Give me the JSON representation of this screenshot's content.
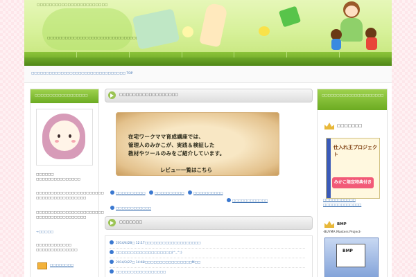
{
  "header": {
    "tagline": "□□□□□□□□□□□□□□□□□□□□□□□",
    "site_title": "□□□□□□□□□□□□□□□□□□□□□□□□□□□□□□□□□□□□□□"
  },
  "nav": {
    "items": [
      "",
      "",
      "",
      "",
      "",
      "",
      ""
    ]
  },
  "breadcrumb": "□□□□□□□□□□□□□□□□□□□□□□□□□□□□□□□□ TOP",
  "left": {
    "head": "□□□□□□□□□□□□□□□□□□",
    "profile_lines": [
      "□□□□□□",
      "□□□□□□□□□□□□□□□",
      "□□□□□□□□□□□□□□□□□□□□□□□",
      "□□□□□□□□□□□□□□□□□",
      "□□□□□□□□□□□□□□□□□□□□□□□",
      "□□□□□□□□□□□□□□□□□"
    ],
    "more_link": "→□□□□□",
    "note_lines": [
      "□□□□□□□□□□□□",
      "□□□□□□□□□□□□□□"
    ],
    "mail_link": "□□□□□□□□"
  },
  "main": {
    "head_title": "□□□□□□□□□□□□□□□□□□",
    "banner_lines": [
      "在宅ワークママ育成講座では、",
      "管理人のみかこが、実践＆検証した",
      "教材やツールのみをご紹介しています。"
    ],
    "banner_cta": "レビュー一覧はこちら",
    "links": [
      "□□□□□□□□□□",
      "□□□□□□□□□□",
      "□□□□□□□□□□",
      "□□□□□□□□□□□□",
      "□□□□□□□□□□□□"
    ],
    "news_head": "□□□□□□□",
    "news": [
      "2014/4/28□ 12:17□□□□□□□□□□□□□□□□□□□",
      "□□□□□□□□□□□□□□□□□□□(^_^;)",
      "2014/3/27□ 14:48□□□□□□□□□□□□□□□□M□□",
      "□□□□□□□□□□□□□□□□□"
    ]
  },
  "right": {
    "head": "□□□□□□□□□□□□□□□□□□□□□",
    "item1_title": "□□□□□□□",
    "book_title": "仕入れ王プロジェクト",
    "book_badge": "みかこ限定特典付き",
    "item1_links": [
      "□□□□□□□□□□□",
      "□□□□□□□□□□□□□"
    ],
    "item2_title": "BMP",
    "item2_sub": "-BUYMA Masters Project-",
    "bmp_label": "BMP"
  }
}
